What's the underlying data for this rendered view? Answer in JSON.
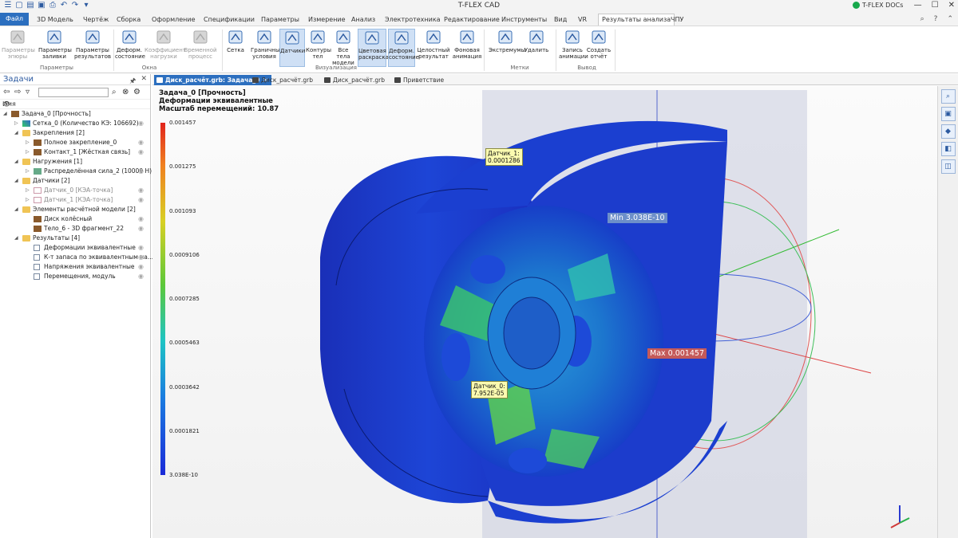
{
  "app": {
    "title": "T-FLEX CAD",
    "docs_button": "T-FLEX DOCs",
    "accent": "#2c6fbf"
  },
  "menu": {
    "file": "Файл",
    "tabs": [
      "3D Модель",
      "Чертёж",
      "Сборка",
      "Оформление",
      "Спецификации",
      "Параметры",
      "Измерение",
      "Анализ",
      "Электротехника",
      "Редактирование",
      "Инструменты",
      "Вид",
      "VR",
      "Результаты анализа",
      "ЧПУ"
    ],
    "active": "Результаты анализа"
  },
  "ribbon": {
    "buttons": [
      {
        "line1": "Параметры",
        "line2": "эпюры",
        "icon": "diagram-params-icon",
        "disabled": true,
        "selected": false
      },
      {
        "line1": "Параметры",
        "line2": "заливки",
        "icon": "fill-params-icon",
        "disabled": false,
        "selected": false
      },
      {
        "line1": "Параметры",
        "line2": "результатов",
        "icon": "result-params-icon",
        "disabled": false,
        "selected": false
      },
      {
        "line1": "Деформ.",
        "line2": "состояние",
        "icon": "deform-state-icon",
        "disabled": false,
        "selected": false
      },
      {
        "line1": "Коэффициент",
        "line2": "нагрузки",
        "icon": "load-factor-icon",
        "disabled": true,
        "selected": false
      },
      {
        "line1": "Временной",
        "line2": "процесс",
        "icon": "time-process-icon",
        "disabled": true,
        "selected": false
      },
      {
        "line1": "Сетка",
        "line2": "",
        "icon": "mesh-icon",
        "disabled": false,
        "selected": false
      },
      {
        "line1": "Граничные",
        "line2": "условия",
        "icon": "boundary-icon",
        "disabled": false,
        "selected": false
      },
      {
        "line1": "Датчики",
        "line2": "",
        "icon": "sensors-icon",
        "disabled": false,
        "selected": true
      },
      {
        "line1": "Контуры",
        "line2": "тел",
        "icon": "contours-icon",
        "disabled": false,
        "selected": false
      },
      {
        "line1": "Все тела",
        "line2": "модели",
        "icon": "all-bodies-icon",
        "disabled": false,
        "selected": false
      },
      {
        "line1": "Цветовая",
        "line2": "раскраска",
        "icon": "color-fill-icon",
        "disabled": false,
        "selected": true
      },
      {
        "line1": "Деформ.",
        "line2": "состояние",
        "icon": "deform-view-icon",
        "disabled": false,
        "selected": true
      },
      {
        "line1": "Целостный",
        "line2": "результат",
        "icon": "whole-result-icon",
        "disabled": false,
        "selected": false
      },
      {
        "line1": "Фоновая",
        "line2": "анимация",
        "icon": "bg-animation-icon",
        "disabled": false,
        "selected": false
      },
      {
        "line1": "Экстремумы",
        "line2": "",
        "icon": "extremes-icon",
        "disabled": false,
        "selected": false
      },
      {
        "line1": "Удалить",
        "line2": "",
        "icon": "delete-icon",
        "disabled": false,
        "selected": false
      },
      {
        "line1": "Запись",
        "line2": "анимации",
        "icon": "record-anim-icon",
        "disabled": false,
        "selected": false
      },
      {
        "line1": "Создать",
        "line2": "отчёт",
        "icon": "create-report-icon",
        "disabled": false,
        "selected": false
      }
    ],
    "groups": [
      "Параметры",
      "Окна",
      "Визуализация",
      "Метки",
      "Вывод"
    ]
  },
  "panel": {
    "title": "Задачи",
    "column": "Имя",
    "tree": [
      {
        "label": "Задача_0 [Прочность]",
        "level": 0,
        "icon": "task-icon",
        "muted": false
      },
      {
        "label": "Сетка_0 (Количество КЭ: 106692)",
        "level": 1,
        "icon": "mesh-icon",
        "muted": false
      },
      {
        "label": "Закрепления [2]",
        "level": 1,
        "icon": "folder-icon",
        "muted": false
      },
      {
        "label": "Полное закрепление_0",
        "level": 2,
        "icon": "fixture-icon",
        "muted": false
      },
      {
        "label": "Контакт_1 [Жёсткая связь]",
        "level": 2,
        "icon": "contact-icon",
        "muted": false
      },
      {
        "label": "Нагружения [1]",
        "level": 1,
        "icon": "folder-icon",
        "muted": false
      },
      {
        "label": "Распределённая сила_2  (10000 Н)",
        "level": 2,
        "icon": "force-icon",
        "muted": false
      },
      {
        "label": "Датчики [2]",
        "level": 1,
        "icon": "folder-icon",
        "muted": false
      },
      {
        "label": "Датчик_0 [КЭА-точка]",
        "level": 2,
        "icon": "sensor-icon",
        "muted": true
      },
      {
        "label": "Датчик_1 [КЭА-точка]",
        "level": 2,
        "icon": "sensor-icon",
        "muted": true
      },
      {
        "label": "Элементы расчётной модели [2]",
        "level": 1,
        "icon": "folder-icon",
        "muted": false
      },
      {
        "label": "Диск колёсный",
        "level": 2,
        "icon": "body-icon",
        "muted": false
      },
      {
        "label": "Тело_6 - 3D фрагмент_22",
        "level": 2,
        "icon": "body-icon",
        "muted": false
      },
      {
        "label": "Результаты [4]",
        "level": 1,
        "icon": "folder-icon",
        "muted": false
      },
      {
        "label": "Деформации эквивалентные",
        "level": 2,
        "icon": "result-icon",
        "muted": false
      },
      {
        "label": "К-т запаса по эквивалентным на...",
        "level": 2,
        "icon": "result-icon",
        "muted": false
      },
      {
        "label": "Напряжения эквивалентные",
        "level": 2,
        "icon": "result-icon",
        "muted": false
      },
      {
        "label": "Перемещения, модуль",
        "level": 2,
        "icon": "result-icon",
        "muted": false
      }
    ]
  },
  "doc_tabs": [
    {
      "label": "Диск_расчёт.grb: Задача_0",
      "active": true
    },
    {
      "label": "Диск_расчёт.grb",
      "active": false
    },
    {
      "label": "Диск_расчёт.grb",
      "active": false
    },
    {
      "label": "Приветствие",
      "active": false
    }
  ],
  "viewport": {
    "info_line1": "Задача_0 [Прочность]",
    "info_line2": "Деформации эквивалентные",
    "info_line3": "Масштаб перемещений: 10.87",
    "scale_ticks": [
      "0.001457",
      "0.001275",
      "0.001093",
      "0.0009106",
      "0.0007285",
      "0.0005463",
      "0.0003642",
      "0.0001821",
      "3.038E-10"
    ],
    "sensor1_name": "Датчик_1:",
    "sensor1_value": "0.0001286",
    "sensor0_name": "Датчик_0:",
    "sensor0_value": "7.952E-05",
    "min_label": "Min 3.038E-10",
    "max_label": "Max 0.001457"
  }
}
